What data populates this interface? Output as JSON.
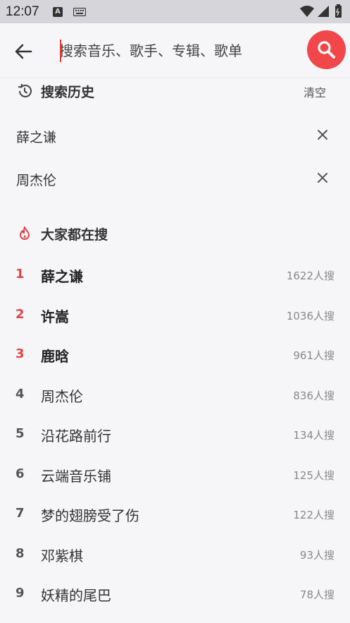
{
  "statusbar": {
    "time": "12:07",
    "a_badge": "A"
  },
  "search": {
    "placeholder": "搜索音乐、歌手、专辑、歌单",
    "accent": "#f2474a"
  },
  "history": {
    "title": "搜索历史",
    "clear_label": "清空",
    "items": [
      {
        "label": "薛之谦"
      },
      {
        "label": "周杰伦"
      }
    ]
  },
  "hot": {
    "title": "大家都在搜",
    "rank_top_color": "#e04545",
    "items": [
      {
        "rank": "1",
        "label": "薛之谦",
        "count": "1622人搜"
      },
      {
        "rank": "2",
        "label": "许嵩",
        "count": "1036人搜"
      },
      {
        "rank": "3",
        "label": "鹿晗",
        "count": "961人搜"
      },
      {
        "rank": "4",
        "label": "周杰伦",
        "count": "836人搜"
      },
      {
        "rank": "5",
        "label": "沿花路前行",
        "count": "134人搜"
      },
      {
        "rank": "6",
        "label": "云端音乐铺",
        "count": "125人搜"
      },
      {
        "rank": "7",
        "label": "梦的翅膀受了伤",
        "count": "122人搜"
      },
      {
        "rank": "8",
        "label": "邓紫棋",
        "count": "93人搜"
      },
      {
        "rank": "9",
        "label": "妖精的尾巴",
        "count": "78人搜"
      }
    ]
  },
  "icons": {
    "back": "arrow-left-icon",
    "search": "magnifier-icon",
    "history": "history-clock-icon",
    "hot": "flame-icon",
    "close": "close-icon"
  }
}
